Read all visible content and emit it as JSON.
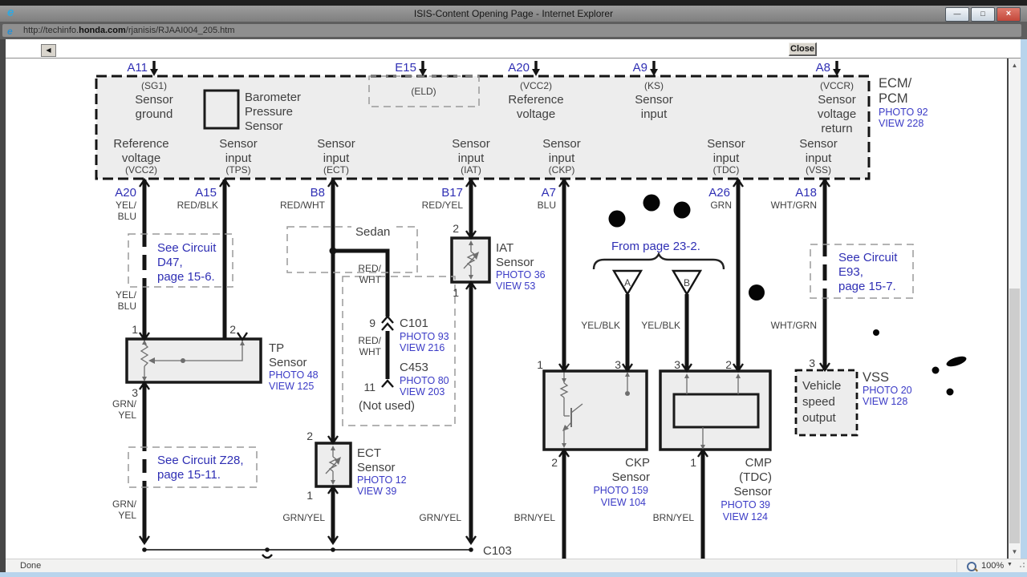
{
  "window": {
    "title": "ISIS-Content Opening Page - Internet Explorer"
  },
  "icons": {
    "ie_logo": "e",
    "minimize": "—",
    "maximize": "□",
    "close_x": "×",
    "back_arrow": "◀",
    "scroll_up": "▲",
    "scroll_down": "▼",
    "zoom_caret": "▼"
  },
  "address": {
    "prefix": "http://techinfo.",
    "domain": "honda.com",
    "path": "/rjanisis/RJAAI004_205.htm"
  },
  "toolbar": {
    "close": "Close"
  },
  "status": {
    "done": "Done",
    "zoom": "100%"
  },
  "colors": {
    "accent_blue": "#2f2fb4",
    "link_blue": "#3b3bc6",
    "text_dark": "#3f3f3f"
  },
  "diagram": {
    "ecm": {
      "l1": "ECM/",
      "l2": "PCM",
      "photo": "PHOTO 92",
      "view": "VIEW 228"
    },
    "top_pins": [
      {
        "id": "A11",
        "sub": "(SG1)",
        "l1": "Sensor",
        "l2": "ground"
      },
      {
        "id": "E15",
        "sub": "(ELD)"
      },
      {
        "id": "A20",
        "sub": "(VCC2)",
        "l1": "Reference",
        "l2": "voltage"
      },
      {
        "id": "A9",
        "sub": "(KS)",
        "l1": "Sensor",
        "l2": "input"
      },
      {
        "id": "A8",
        "sub": "(VCCR)",
        "l1": "Sensor",
        "l2": "voltage",
        "l3": "return"
      }
    ],
    "barometer": {
      "l1": "Barometer",
      "l2": "Pressure",
      "l3": "Sensor"
    },
    "bottom_cols": [
      {
        "id": "A20",
        "l1": "Reference",
        "l2": "voltage",
        "sub": "(VCC2)",
        "wire1": "YEL/",
        "wire2": "BLU"
      },
      {
        "id": "A15",
        "l1": "Sensor",
        "l2": "input",
        "sub": "(TPS)",
        "wire": "RED/BLK"
      },
      {
        "id": "B8",
        "l1": "Sensor",
        "l2": "input",
        "sub": "(ECT)",
        "wire": "RED/WHT"
      },
      {
        "id": "B17",
        "l1": "Sensor",
        "l2": "input",
        "sub": "(IAT)",
        "wire": "RED/YEL"
      },
      {
        "id": "A7",
        "l1": "Sensor",
        "l2": "input",
        "sub": "(CKP)",
        "wire": "BLU"
      },
      {
        "id": "A26",
        "l1": "Sensor",
        "l2": "input",
        "sub": "(TDC)",
        "wire": "GRN"
      },
      {
        "id": "A18",
        "l1": "Sensor",
        "l2": "input",
        "sub": "(VSS)",
        "wire": "WHT/GRN"
      }
    ],
    "labels": {
      "yel": "YEL/",
      "blu": "BLU",
      "grn": "GRN/",
      "yel2": "YEL",
      "red": "RED/",
      "wht": "WHT",
      "grn_yel": "GRN/YEL",
      "brn_yel": "BRN/YEL",
      "yel_blk": "YEL/BLK",
      "wht_grn": "WHT/GRN"
    },
    "notes": {
      "d47": {
        "l1": "See Circuit",
        "l2": "D47,",
        "l3": "page 15-6."
      },
      "z28": {
        "l1": "See Circuit Z28,",
        "l2": "page 15-11."
      },
      "e93": {
        "l1": "See Circuit",
        "l2": "E93,",
        "l3": "page 15-7."
      },
      "from_page": "From page 23-2.",
      "sedan": "Sedan",
      "not_used": "(Not used)"
    },
    "connectors": {
      "c101": {
        "id": "C101",
        "photo": "PHOTO 93",
        "view": "VIEW 216",
        "pin": "9"
      },
      "c453": {
        "id": "C453",
        "photo": "PHOTO 80",
        "view": "VIEW 203",
        "pin": "11"
      },
      "c103": {
        "id": "C103"
      }
    },
    "sensors": {
      "tp": {
        "l1": "TP",
        "l2": "Sensor",
        "photo": "PHOTO 48",
        "view": "VIEW 125",
        "p1": "1",
        "p2": "2",
        "p3": "3"
      },
      "ect": {
        "l1": "ECT",
        "l2": "Sensor",
        "photo": "PHOTO 12",
        "view": "VIEW 39",
        "p1": "1",
        "p2": "2"
      },
      "iat": {
        "l1": "IAT",
        "l2": "Sensor",
        "photo": "PHOTO 36",
        "view": "VIEW 53",
        "p1": "1",
        "p2": "2"
      },
      "ckp": {
        "l1": "CKP",
        "l2": "Sensor",
        "photo": "PHOTO 159",
        "view": "VIEW 104",
        "p1": "1",
        "p2": "2",
        "p3": "3"
      },
      "cmp": {
        "l1": "CMP",
        "l2": "(TDC)",
        "l3": "Sensor",
        "photo": "PHOTO 39",
        "view": "VIEW 124",
        "p1": "1",
        "p2": "2",
        "p3": "3"
      },
      "vss": {
        "name": "VSS",
        "photo": "PHOTO 20",
        "view": "VIEW 128",
        "p3": "3",
        "b1": "Vehicle",
        "b2": "speed",
        "b3": "output"
      }
    },
    "triangles": {
      "a": "A",
      "b": "B"
    }
  }
}
